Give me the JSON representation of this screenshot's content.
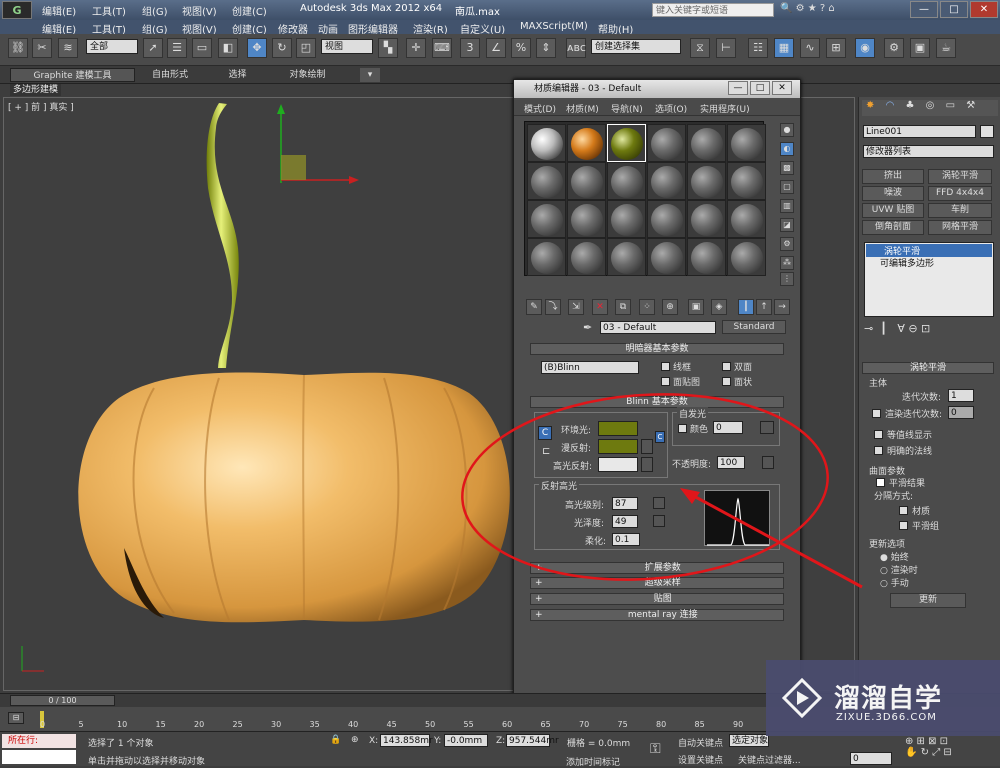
{
  "titlebar": {
    "logo": "G",
    "menus": [
      "编辑(E)",
      "工具(T)",
      "组(G)",
      "视图(V)",
      "创建(C)",
      "修改器",
      "动画",
      "图形编辑器",
      "渲染(R)",
      "自定义(U)",
      "MAXScript(M)",
      "帮助(H)"
    ],
    "app_title": "Autodesk 3ds Max  2012 x64",
    "file": "南瓜.max",
    "search_placeholder": "键入关键字或短语",
    "win": [
      "—",
      "□",
      "✕"
    ]
  },
  "toolbar": {
    "filter": "全部",
    "view": "视图",
    "selset": "创建选择集"
  },
  "ribbon": {
    "tabs": [
      "Graphite 建模工具",
      "自由形式",
      "选择",
      "对象绘制"
    ],
    "subtab": "多边形建模"
  },
  "viewport": {
    "label": "[ + ] 前 ] 真实 ]"
  },
  "cmdpanel": {
    "object_name": "Line001",
    "modifier_list": "修改器列表",
    "buttons": [
      "挤出",
      "涡轮平滑",
      "噪波",
      "FFD 4x4x4",
      "UVW 贴图",
      "车削",
      "倒角剖面",
      "网格平滑"
    ],
    "stack": [
      "涡轮平滑",
      "可编辑多边形"
    ],
    "turbo_header": "涡轮平滑",
    "main_group": "主体",
    "iterations_label": "迭代次数:",
    "iterations_value": "1",
    "render_iters_label": "渲染迭代次数:",
    "render_iters_value": "0",
    "isoline": "等值线显示",
    "explicit_normals": "明确的法线",
    "surface_group": "曲面参数",
    "smooth_result": "平滑结果",
    "separate_label": "分隔方式:",
    "sep_material": "材质",
    "sep_smooth": "平滑组",
    "update_group": "更新选项",
    "update_always": "始终",
    "update_render": "渲染时",
    "update_manual": "手动",
    "update_button": "更新"
  },
  "mated": {
    "title": "材质编辑器 - 03 - Default",
    "menus": [
      "模式(D)",
      "材质(M)",
      "导航(N)",
      "选项(O)",
      "实用程序(U)"
    ],
    "material_name": "03 - Default",
    "material_type": "Standard",
    "shader_header": "明暗器基本参数",
    "shader": "(B)Blinn",
    "wire": "线框",
    "twosided": "双面",
    "facemap": "面贴图",
    "faceted": "面状",
    "blinn_header": "Blinn 基本参数",
    "selfillum": "自发光",
    "color_label": "颜色",
    "color_value": "0",
    "ambient": "环境光:",
    "diffuse": "漫反射:",
    "specular": "高光反射:",
    "opacity_label": "不透明度:",
    "opacity_value": "100",
    "spec_group": "反射高光",
    "spec_level_label": "高光级别:",
    "spec_level": "87",
    "gloss_label": "光泽度:",
    "gloss": "49",
    "soften_label": "柔化:",
    "soften": "0.1",
    "rollouts": [
      "扩展参数",
      "超级采样",
      "贴图",
      "mental ray 连接"
    ],
    "ambient_color": "#6e7a0f",
    "diffuse_color": "#6e7a0f",
    "specular_color": "#e8e8e8"
  },
  "timeline": {
    "frame": "0 / 100",
    "ticks": [
      "0",
      "5",
      "10",
      "15",
      "20",
      "25",
      "30",
      "35",
      "40",
      "45",
      "50",
      "55",
      "60",
      "65",
      "70",
      "75",
      "80",
      "85",
      "90"
    ]
  },
  "status": {
    "running": "所在行:",
    "selected": "选择了 1 个对象",
    "hint": "单击并拖动以选择并移动对象",
    "x_label": "X:",
    "x": "143.858mr",
    "y_label": "Y:",
    "y": "-0.0mm",
    "z_label": "Z:",
    "z": "957.544mr",
    "grid": "栅格 = 0.0mm",
    "autokey": "自动关键点",
    "selected_obj": "选定对象",
    "setkey": "设置关键点",
    "keyfilter": "关键点过滤器...",
    "addtime": "添加时间标记",
    "frame_value": "0"
  },
  "watermark": {
    "brand": "溜溜自学",
    "url": "ZIXUE.3D66.COM"
  }
}
